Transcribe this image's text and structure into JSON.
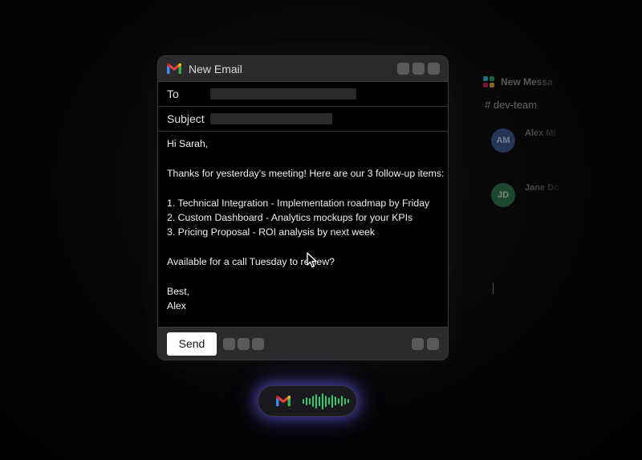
{
  "slack": {
    "title": "New Messa",
    "channel": "# dev-team",
    "messages": [
      {
        "initials": "AM",
        "name": "Alex Mi",
        "color": "#3b5b9a"
      },
      {
        "initials": "JD",
        "name": "Jane Do",
        "color": "#2e7d4f"
      }
    ]
  },
  "compose": {
    "title": "New Email",
    "to_label": "To",
    "subject_label": "Subject",
    "body_lines": [
      "Hi Sarah,",
      "",
      "Thanks for yesterday's meeting! Here are our 3 follow-up items:",
      "",
      "1. Technical Integration - Implementation roadmap by Friday",
      "2. Custom Dashboard - Analytics mockups for your KPIs",
      "3. Pricing Proposal - ROI analysis by next week",
      "",
      "Available for a call Tuesday to review?",
      "",
      "Best,",
      "Alex"
    ],
    "send_label": "Send"
  },
  "voice": {
    "status_color": "#2ecc71"
  },
  "colors": {
    "accent": "#2ecc71",
    "gmail_red": "#ea4335"
  }
}
